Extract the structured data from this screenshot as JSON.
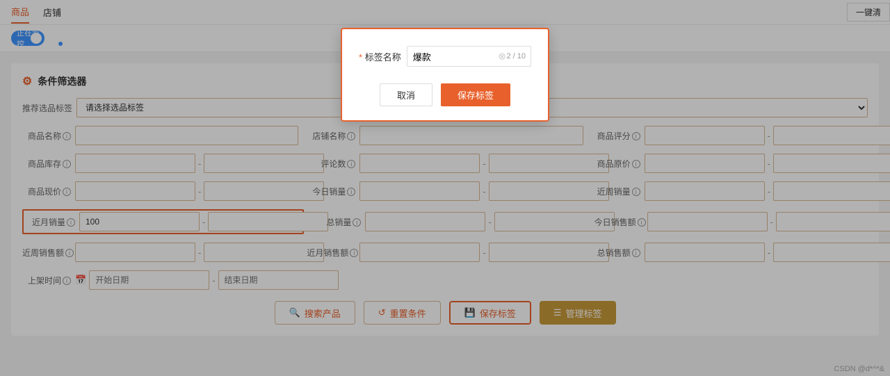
{
  "nav": {
    "items": [
      {
        "label": "商品",
        "active": true
      },
      {
        "label": "店铺",
        "active": false
      }
    ]
  },
  "monitor": {
    "toggle_label": "正在监控",
    "one_click_btn": "一键清"
  },
  "filter": {
    "title": "条件筛选器",
    "tag_select_label": "推荐选品标签",
    "tag_select_placeholder": "请选择选品标签",
    "rows": [
      {
        "items": [
          {
            "label": "商品名称",
            "has_info": true,
            "type": "input",
            "value": ""
          },
          {
            "label": "店铺名称",
            "has_info": true,
            "type": "input",
            "value": ""
          },
          {
            "label": "商品评分",
            "has_info": true,
            "type": "range",
            "from": "",
            "to": ""
          }
        ]
      },
      {
        "items": [
          {
            "label": "商品库存",
            "has_info": true,
            "type": "range",
            "from": "",
            "to": ""
          },
          {
            "label": "评论数",
            "has_info": true,
            "type": "range",
            "from": "",
            "to": ""
          },
          {
            "label": "商品原价",
            "has_info": true,
            "type": "range",
            "from": "",
            "to": ""
          }
        ]
      },
      {
        "items": [
          {
            "label": "商品现价",
            "has_info": true,
            "type": "range",
            "from": "",
            "to": ""
          },
          {
            "label": "今日销量",
            "has_info": true,
            "type": "range",
            "from": "",
            "to": ""
          },
          {
            "label": "近周销量",
            "has_info": true,
            "type": "range",
            "from": "",
            "to": ""
          }
        ]
      },
      {
        "items": [
          {
            "label": "近月销量",
            "has_info": true,
            "type": "range",
            "from": "100",
            "to": "",
            "highlighted": true
          },
          {
            "label": "总销量",
            "has_info": true,
            "type": "range",
            "from": "",
            "to": ""
          },
          {
            "label": "今日销售额",
            "has_info": true,
            "type": "range",
            "from": "",
            "to": ""
          }
        ]
      },
      {
        "items": [
          {
            "label": "近周销售额",
            "has_info": true,
            "type": "range",
            "from": "",
            "to": ""
          },
          {
            "label": "近月销售额",
            "has_info": true,
            "type": "range",
            "from": "",
            "to": ""
          },
          {
            "label": "总销售额",
            "has_info": true,
            "type": "range",
            "from": "",
            "to": ""
          }
        ]
      },
      {
        "items": [
          {
            "label": "上架时间",
            "has_info": true,
            "type": "date",
            "start_placeholder": "开始日期",
            "end_placeholder": "结束日期"
          }
        ]
      }
    ]
  },
  "actions": {
    "search_label": "搜索产品",
    "reset_label": "重置条件",
    "save_tag_label": "保存标签",
    "manage_tag_label": "管理标签"
  },
  "dialog": {
    "title": "标签名称",
    "required_mark": "*",
    "input_value": "爆款",
    "counter": "2 / 10",
    "cancel_label": "取消",
    "confirm_label": "保存标签"
  },
  "watermark": "CSDN @d*^*&"
}
